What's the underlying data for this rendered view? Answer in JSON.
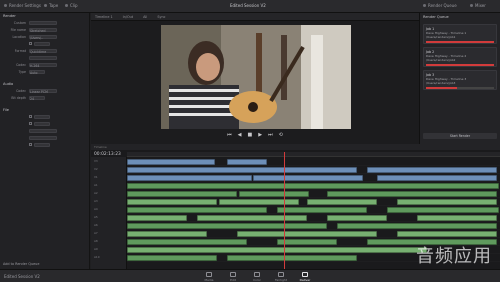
{
  "topbar": {
    "render_settings": "Render Settings",
    "tape": "Tape",
    "clip": "Clip",
    "project_title": "Edited Session V2",
    "right_label": "Render Queue",
    "far_right": "Mixer"
  },
  "left": {
    "section_render": "Render",
    "rows": [
      {
        "label": "Custom",
        "value": ""
      },
      {
        "label": "File name",
        "value": "Stretched"
      },
      {
        "label": "Location",
        "value": "/Users/.."
      },
      {
        "label": "",
        "value": ""
      },
      {
        "label": "Format",
        "value": "Quicktime"
      },
      {
        "label": "",
        "value": ""
      },
      {
        "label": "Codec",
        "value": "H.264"
      },
      {
        "label": "Type",
        "value": "Auto"
      }
    ],
    "section_audio": "Audio",
    "audio_rows": [
      {
        "label": "Codec",
        "value": "Linear PCM"
      },
      {
        "label": "Bit depth",
        "value": "24"
      }
    ],
    "section_file": "File",
    "bottom_button": "Add to Render Queue"
  },
  "center": {
    "source_label": "Timeline 1",
    "tabs": [
      "In/Out",
      "All",
      "Sync"
    ],
    "timecode": "00:02:13:23"
  },
  "transport": {
    "prev": "⏮",
    "rewind": "◀",
    "stop": "■",
    "play": "▶",
    "next": "⏭",
    "loop": "⟲"
  },
  "right": {
    "header": "Render Queue",
    "jobs": [
      {
        "title": "Job 1",
        "name": "Dave Highway - Timeline 1",
        "path": "/Users/renders/job1",
        "progress": 1.0
      },
      {
        "title": "Job 2",
        "name": "Dave Highway - Timeline 2",
        "path": "/Users/renders/job2",
        "progress": 1.0
      },
      {
        "title": "Job 3",
        "name": "Dave Highway - Timeline 3",
        "path": "/Users/renders/job3",
        "progress": 0.45
      }
    ],
    "start_render": "Start Render"
  },
  "timeline": {
    "toolbar": "Timeline",
    "timecode": "00:02:13:23",
    "tracks": [
      "V3",
      "V2",
      "V1",
      "A1",
      "A2",
      "A3",
      "A4",
      "A5",
      "A6",
      "A7",
      "A8",
      "A9",
      "A10",
      "A11"
    ]
  },
  "bottombar": {
    "project": "Edited Session V2",
    "pages": [
      "Media",
      "Edit",
      "Color",
      "Fairlight",
      "Deliver"
    ],
    "active_page": "Deliver"
  },
  "watermark": "音频应用"
}
